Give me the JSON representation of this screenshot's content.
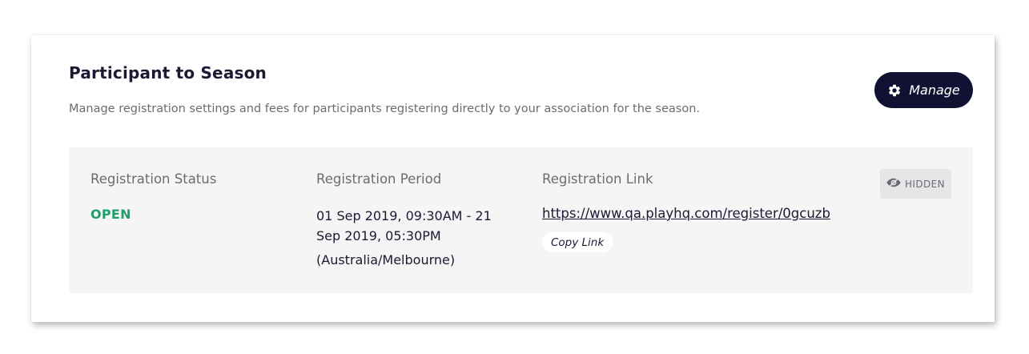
{
  "card": {
    "title": "Participant to Season",
    "description": "Manage registration settings and fees for participants registering directly to your association for the season.",
    "manage_label": "Manage"
  },
  "details": {
    "status_label": "Registration Status",
    "status_value": "OPEN",
    "period_label": "Registration Period",
    "period_value": "01 Sep 2019, 09:30AM - 21 Sep 2019, 05:30PM",
    "period_timezone": "(Australia/Melbourne)",
    "link_label": "Registration Link",
    "link_value": "https://www.qa.playhq.com/register/0gcuzb",
    "copy_link_label": "Copy Link",
    "visibility_badge": "HIDDEN"
  },
  "colors": {
    "brand_dark": "#111133",
    "status_open": "#1f9d6b",
    "panel_bg": "#f5f5f5"
  },
  "icons": {
    "manage": "gear-icon",
    "visibility": "eye-hidden-icon"
  }
}
